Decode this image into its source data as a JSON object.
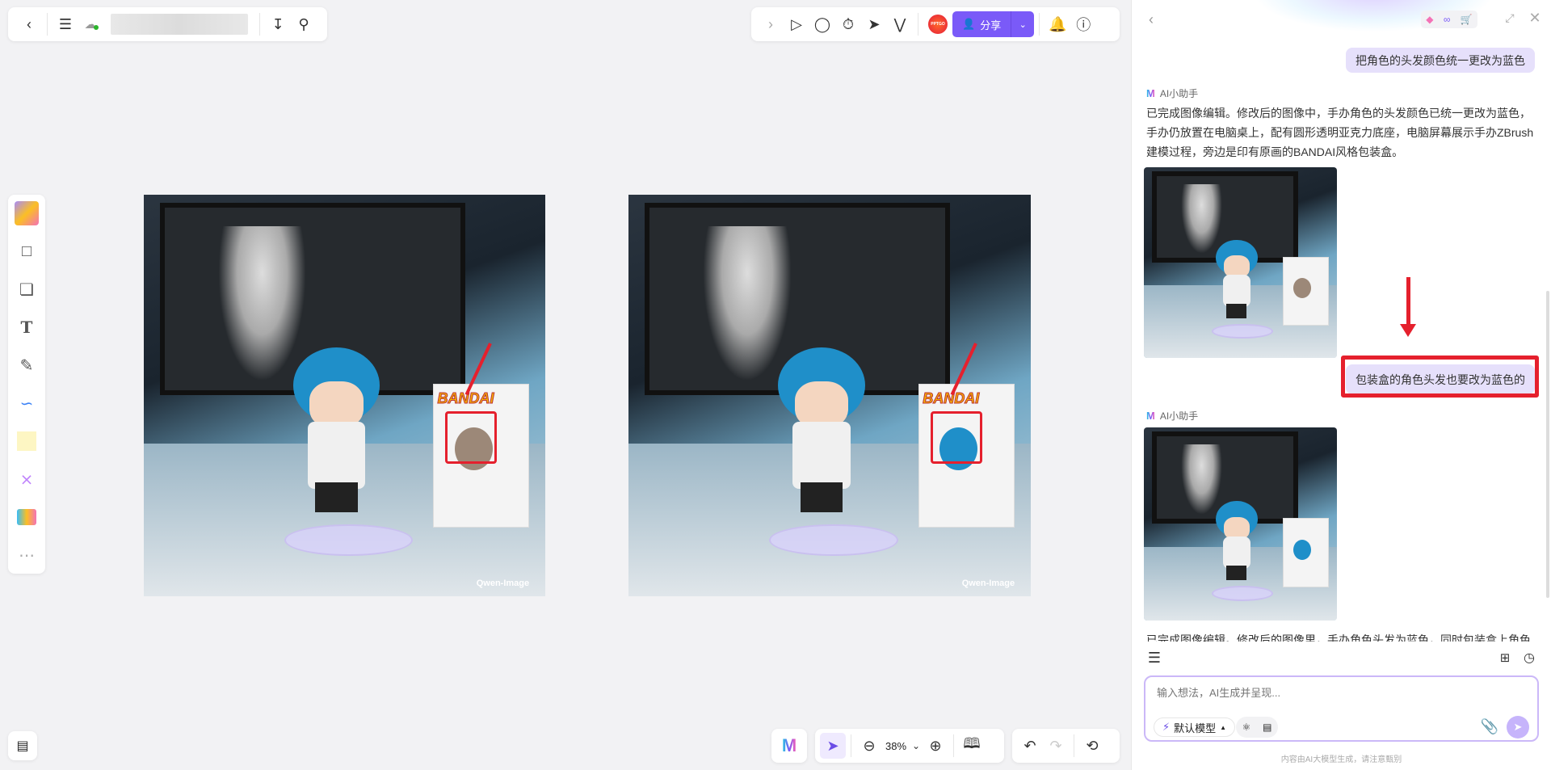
{
  "topbar": {
    "back": "back-icon",
    "menu": "menu-icon",
    "cloud": "cloud-icon",
    "download": "download-icon",
    "search": "search-icon"
  },
  "toolbar_right": {
    "avatar_text": "PPTGO",
    "share_label": "分享"
  },
  "canvas": {
    "images": [
      {
        "box_brand": "BANDAI",
        "watermark": "Qwen-Image"
      },
      {
        "box_brand": "BANDAI",
        "watermark": "Qwen-Image"
      }
    ]
  },
  "zoom": {
    "level": "38%"
  },
  "chat": {
    "user_messages": [
      "把角色的头发颜色统一更改为蓝色",
      "包装盒的角色头发也要改为蓝色的"
    ],
    "assistant_name": "AI小助手",
    "assistant_reply_1": "已完成图像编辑。修改后的图像中，手办角色的头发颜色已统一更改为蓝色，手办仍放置在电脑桌上，配有圆形透明亚克力底座，电脑屏幕展示手办ZBrush建模过程，旁边是印有原画的BANDAI风格包装盒。",
    "assistant_reply_2_partial": "已完成图像编辑。修改后的图像里，手办角色头发为蓝色，同时包装盒上角色",
    "input_placeholder": "输入想法，AI生成并呈现...",
    "model_label": "默认模型",
    "footer": "内容由AI大模型生成，请注意甄别"
  },
  "colors": {
    "accent": "#7a5af8",
    "highlight": "#e5202d",
    "bubble": "#e6e0fb"
  }
}
